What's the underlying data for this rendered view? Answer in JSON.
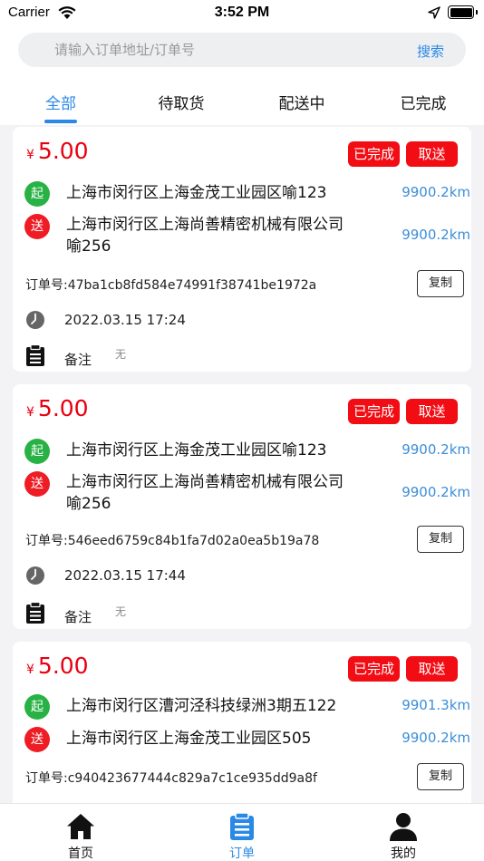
{
  "status_bar": {
    "carrier": "Carrier",
    "time": "3:52 PM"
  },
  "search": {
    "placeholder": "请输入订单地址/订单号",
    "button_label": "搜索"
  },
  "tabs": [
    {
      "label": "全部",
      "active": true
    },
    {
      "label": "待取货",
      "active": false
    },
    {
      "label": "配送中",
      "active": false
    },
    {
      "label": "已完成",
      "active": false
    }
  ],
  "orders": [
    {
      "currency": "¥",
      "price": "5.00",
      "status_badge": "已完成",
      "action_badge": "取送",
      "start_tag": "起",
      "start_address": "上海市闵行区上海金茂工业园区喻123",
      "start_distance": "9900.2km",
      "end_tag": "送",
      "end_address": "上海市闵行区上海尚善精密机械有限公司喻256",
      "end_distance": "9900.2km",
      "order_no": "订单号:47ba1cb8fd584e74991f38741be1972a",
      "copy_label": "复制",
      "time": "2022.03.15 17:24",
      "note_label": "备注",
      "note_value": "无"
    },
    {
      "currency": "¥",
      "price": "5.00",
      "status_badge": "已完成",
      "action_badge": "取送",
      "start_tag": "起",
      "start_address": "上海市闵行区上海金茂工业园区喻123",
      "start_distance": "9900.2km",
      "end_tag": "送",
      "end_address": "上海市闵行区上海尚善精密机械有限公司喻256",
      "end_distance": "9900.2km",
      "order_no": "订单号:546eed6759c84b1fa7d02a0ea5b19a78",
      "copy_label": "复制",
      "time": "2022.03.15 17:44",
      "note_label": "备注",
      "note_value": "无"
    },
    {
      "currency": "¥",
      "price": "5.00",
      "status_badge": "已完成",
      "action_badge": "取送",
      "start_tag": "起",
      "start_address": "上海市闵行区漕河泾科技绿洲3期五122",
      "start_distance": "9901.3km",
      "end_tag": "送",
      "end_address": "上海市闵行区上海金茂工业园区505",
      "end_distance": "9900.2km",
      "order_no": "订单号:c940423677444c829a7c1ce935dd9a8f",
      "copy_label": "复制"
    }
  ],
  "tabbar": [
    {
      "label": "首页",
      "icon": "home-icon",
      "active": false
    },
    {
      "label": "订单",
      "icon": "order-list-icon",
      "active": true
    },
    {
      "label": "我的",
      "icon": "profile-icon",
      "active": false
    }
  ],
  "colors": {
    "accent": "#2b89e6",
    "price_red": "#e8000f",
    "badge_red": "#f20d14",
    "start_green": "#28b245",
    "end_red": "#ee1c25",
    "distance_blue": "#3b8ed8"
  }
}
